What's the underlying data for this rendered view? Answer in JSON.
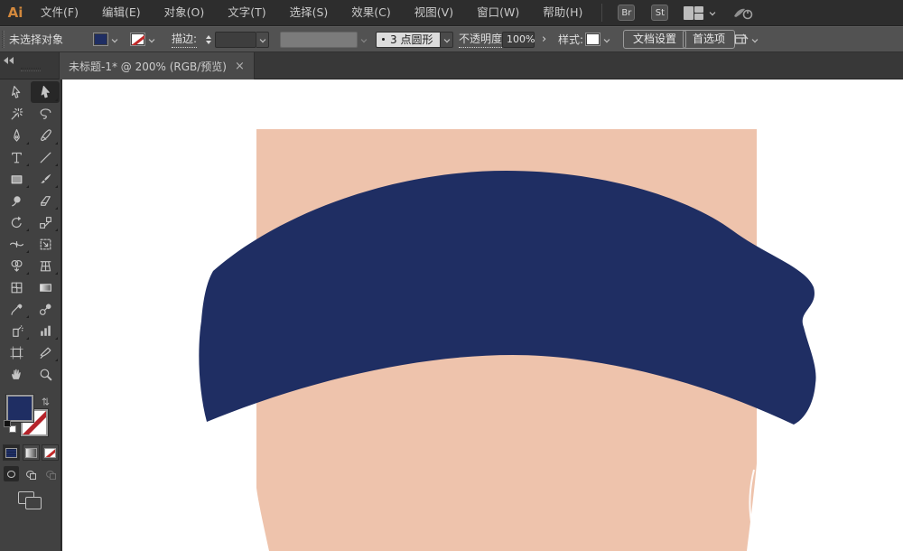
{
  "menubar": {
    "logo": "Ai",
    "items": [
      {
        "key": "file",
        "label": "文件(F)"
      },
      {
        "key": "edit",
        "label": "编辑(E)"
      },
      {
        "key": "object",
        "label": "对象(O)"
      },
      {
        "key": "type",
        "label": "文字(T)"
      },
      {
        "key": "select",
        "label": "选择(S)"
      },
      {
        "key": "effect",
        "label": "效果(C)"
      },
      {
        "key": "view",
        "label": "视图(V)"
      },
      {
        "key": "window",
        "label": "窗口(W)"
      },
      {
        "key": "help",
        "label": "帮助(H)"
      }
    ],
    "badges": [
      "Br",
      "St"
    ],
    "icons": [
      "workspace-switcher-icon",
      "cs-live-icon"
    ]
  },
  "controlbar": {
    "no_selection_label": "未选择对象",
    "fill_color": "#1f2e63",
    "stroke_style": "none",
    "stroke_label": "描边:",
    "brush_bullet": "brush-dot-icon",
    "brush_label": "3 点圆形",
    "opacity_label": "不透明度:",
    "opacity_value": "100%",
    "opacity_arrow": "›",
    "style_label": "样式:",
    "style_swatch_color": "#ffffff",
    "doc_setup_button": "文档设置",
    "preferences_button": "首选项"
  },
  "tabbar": {
    "title": "未标题-1* @ 200% (RGB/预览)",
    "close_glyph": "×",
    "zoom_level": "200%",
    "color_mode": "RGB/预览",
    "doc_name": "未标题-1*"
  },
  "toolbar": {
    "tools": [
      {
        "name": "selection-tool",
        "icon": "selection",
        "active": false,
        "flyout": false
      },
      {
        "name": "direct-selection-tool",
        "icon": "direct-selection",
        "active": true,
        "flyout": true
      },
      {
        "name": "magic-wand-tool",
        "icon": "magic-wand",
        "active": false,
        "flyout": false
      },
      {
        "name": "lasso-tool",
        "icon": "lasso",
        "active": false,
        "flyout": false
      },
      {
        "name": "pen-tool",
        "icon": "pen",
        "active": false,
        "flyout": true
      },
      {
        "name": "pencil-tool",
        "icon": "pencil",
        "active": false,
        "flyout": true
      },
      {
        "name": "type-tool",
        "icon": "type",
        "active": false,
        "flyout": true
      },
      {
        "name": "line-segment-tool",
        "icon": "line-segment",
        "active": false,
        "flyout": true
      },
      {
        "name": "rectangle-tool",
        "icon": "rectangle",
        "active": false,
        "flyout": true
      },
      {
        "name": "paintbrush-tool",
        "icon": "paintbrush",
        "active": false,
        "flyout": true
      },
      {
        "name": "blob-brush-tool",
        "icon": "blob-brush",
        "active": false,
        "flyout": false
      },
      {
        "name": "eraser-tool",
        "icon": "eraser",
        "active": false,
        "flyout": true
      },
      {
        "name": "rotate-tool",
        "icon": "rotate",
        "active": false,
        "flyout": true
      },
      {
        "name": "scale-tool",
        "icon": "scale",
        "active": false,
        "flyout": true
      },
      {
        "name": "width-tool",
        "icon": "width",
        "active": false,
        "flyout": true
      },
      {
        "name": "free-transform-tool",
        "icon": "free-transform",
        "active": false,
        "flyout": false
      },
      {
        "name": "shape-builder-tool",
        "icon": "shape-builder",
        "active": false,
        "flyout": true
      },
      {
        "name": "perspective-grid-tool",
        "icon": "perspective-grid",
        "active": false,
        "flyout": true
      },
      {
        "name": "mesh-tool",
        "icon": "mesh",
        "active": false,
        "flyout": false
      },
      {
        "name": "gradient-tool",
        "icon": "gradient",
        "active": false,
        "flyout": false
      },
      {
        "name": "eyedropper-tool",
        "icon": "eyedropper",
        "active": false,
        "flyout": true
      },
      {
        "name": "blend-tool",
        "icon": "blend",
        "active": false,
        "flyout": false
      },
      {
        "name": "symbol-sprayer-tool",
        "icon": "symbol-sprayer",
        "active": false,
        "flyout": true
      },
      {
        "name": "column-graph-tool",
        "icon": "column-graph",
        "active": false,
        "flyout": true
      },
      {
        "name": "artboard-tool",
        "icon": "artboard",
        "active": false,
        "flyout": false
      },
      {
        "name": "slice-tool",
        "icon": "slice",
        "active": false,
        "flyout": true
      },
      {
        "name": "hand-tool",
        "icon": "hand",
        "active": false,
        "flyout": false
      },
      {
        "name": "zoom-tool",
        "icon": "zoom",
        "active": false,
        "flyout": false
      }
    ]
  },
  "canvas": {
    "skin_color": "#eec3ac",
    "shape_color": "#1f2e63",
    "artboard_background": "#ffffff"
  }
}
